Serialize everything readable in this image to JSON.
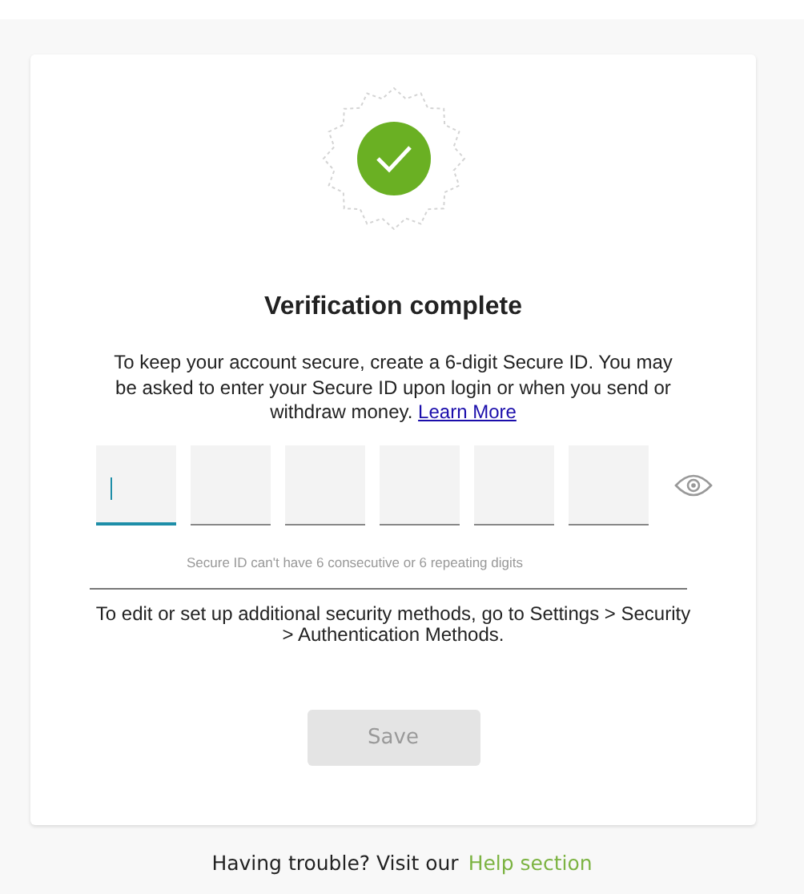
{
  "card": {
    "title": "Verification complete",
    "intro": "To keep your account secure, create a 6-digit Secure ID. You may be asked to enter your Secure ID upon login or when you send or withdraw money. ",
    "intro_link": "Learn More",
    "digit_boxes": [
      {
        "focused": true
      },
      {
        "focused": false
      },
      {
        "focused": false
      },
      {
        "focused": false
      },
      {
        "focused": false
      },
      {
        "focused": false
      }
    ],
    "hint": "Secure ID can't have 6 consecutive or 6 repeating digits",
    "note": "To edit or set up additional security methods, go to Settings > Security > Authentication Methods.",
    "save_button": {
      "label": "Save",
      "disabled": true
    }
  },
  "footer": {
    "text": "Having trouble? Visit our",
    "link": "Help section"
  }
}
